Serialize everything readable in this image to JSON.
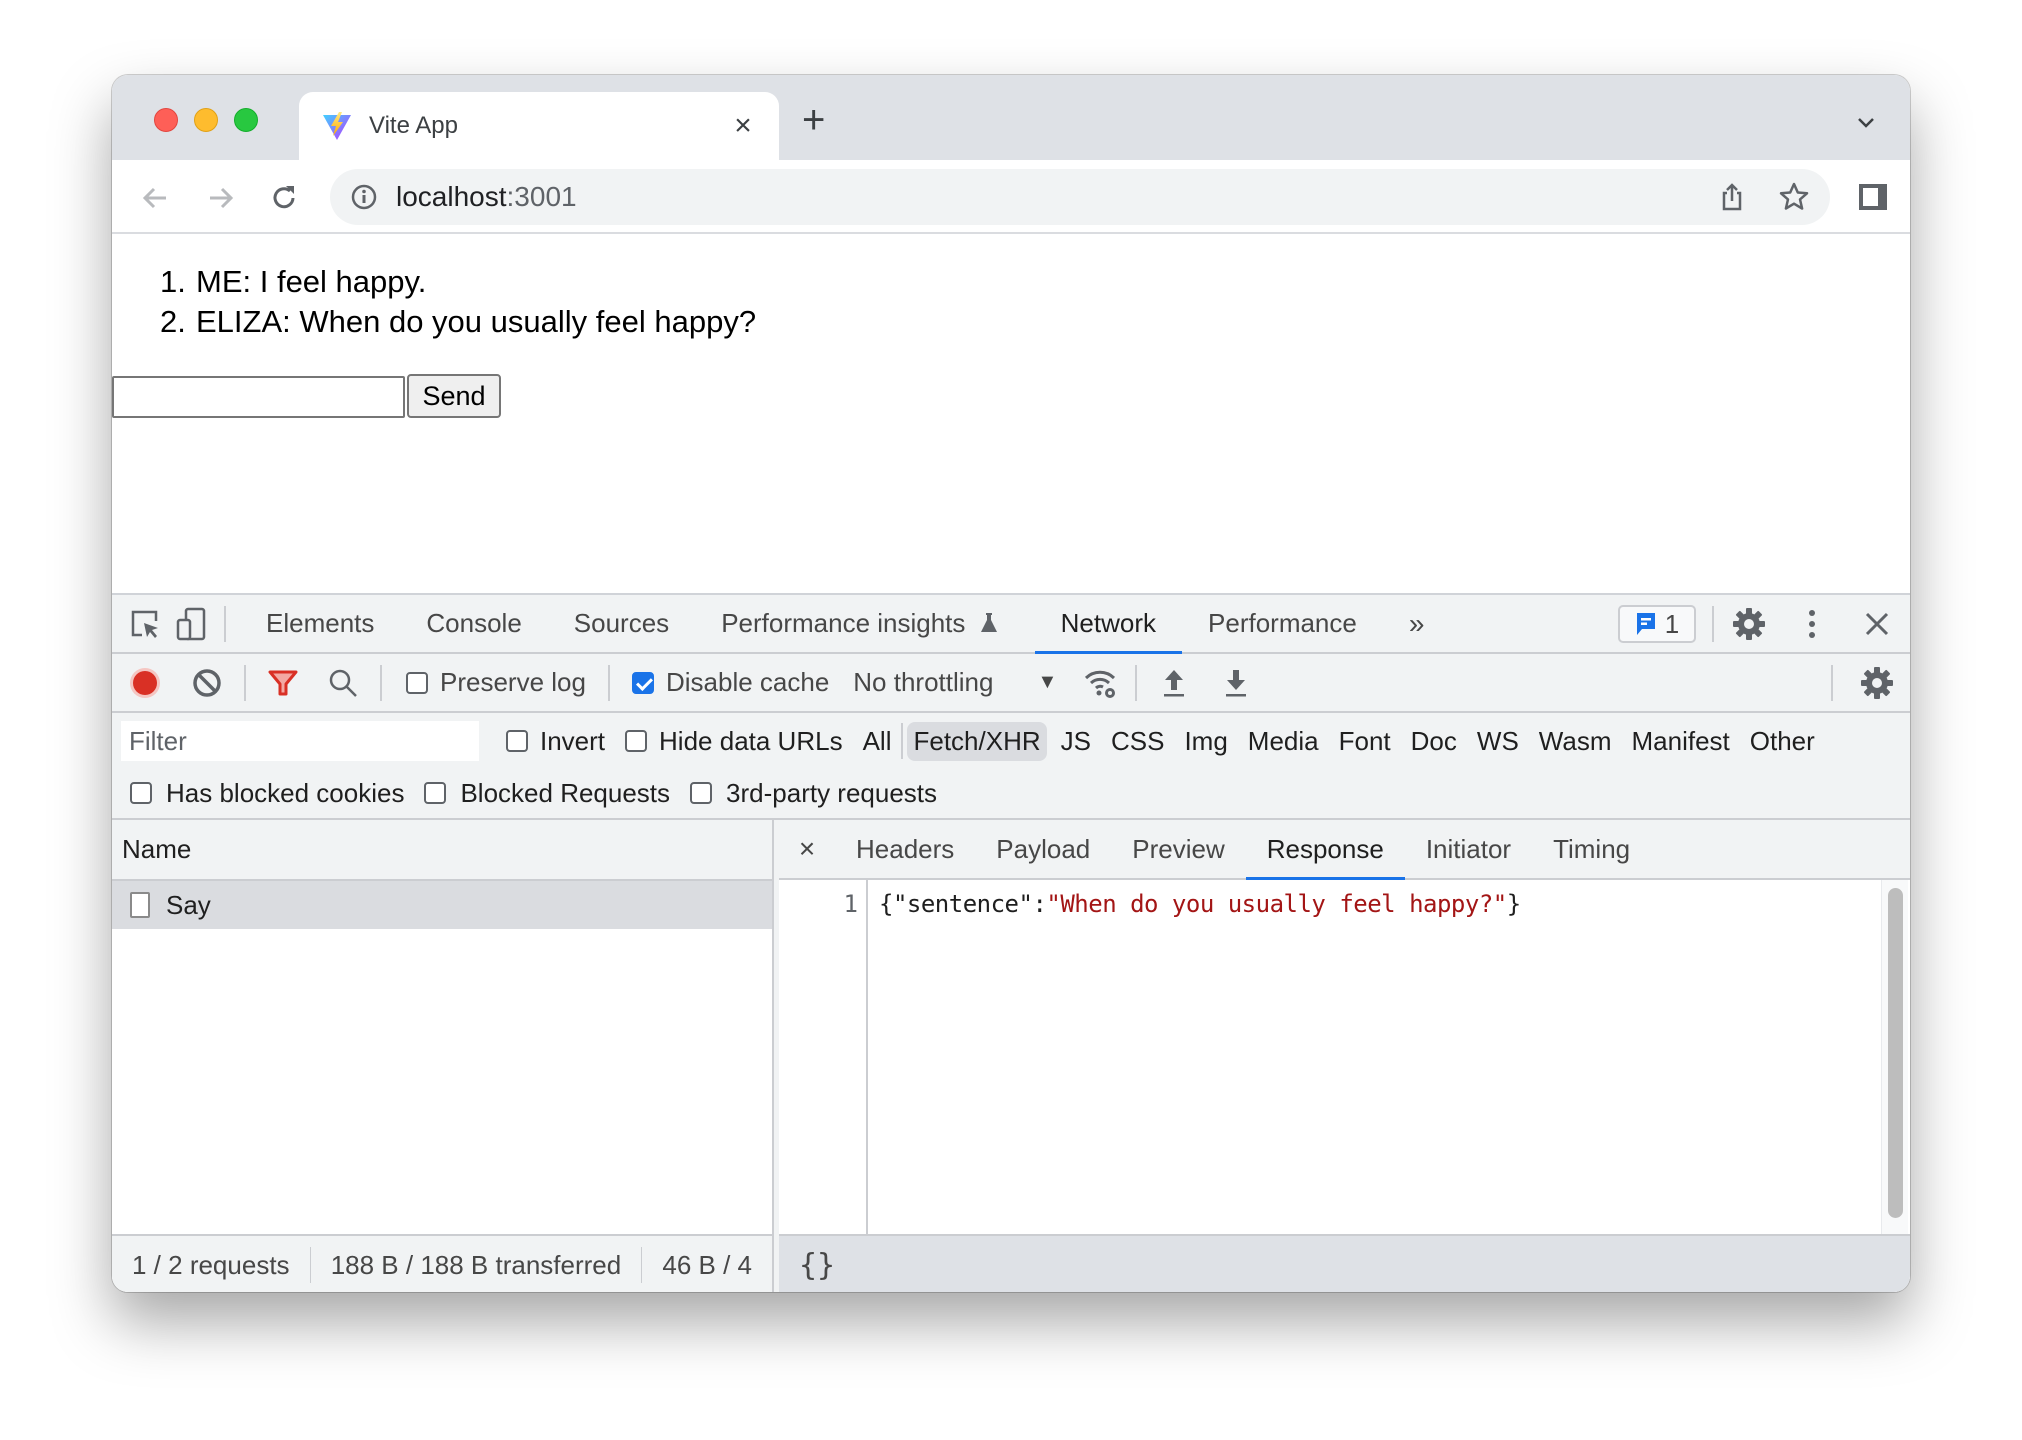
{
  "browser": {
    "tab": {
      "title": "Vite App",
      "favicon": "vite-logo-icon",
      "close_icon": "close-icon"
    },
    "new_tab_icon": "plus-icon",
    "tab_list_icon": "chevron-down-icon",
    "nav": {
      "back_icon": "arrow-left-icon",
      "forward_icon": "arrow-right-icon",
      "reload_icon": "reload-icon"
    },
    "address": {
      "host": "localhost",
      "port": ":3001",
      "info_icon": "info-icon"
    },
    "address_actions": [
      "share-icon",
      "bookmark-star-icon"
    ],
    "side_panel_icon": "side-panel-icon",
    "traffic_lights": {
      "close": "#fe5f57",
      "minimize": "#febc2e",
      "maximize": "#28c840"
    }
  },
  "page": {
    "messages": [
      {
        "num": "1.",
        "text": "ME: I feel happy."
      },
      {
        "num": "2.",
        "text": "ELIZA: When do you usually feel happy?"
      }
    ],
    "input": {
      "value": "",
      "placeholder": ""
    },
    "send_label": "Send"
  },
  "devtools": {
    "tabs": [
      {
        "label": "Elements",
        "active": false
      },
      {
        "label": "Console",
        "active": false
      },
      {
        "label": "Sources",
        "active": false
      },
      {
        "label": "Performance insights",
        "active": false,
        "icon": "flask-icon"
      },
      {
        "label": "Network",
        "active": true
      },
      {
        "label": "Performance",
        "active": false
      }
    ],
    "more_tabs_icon": "double-chevron-right-icon",
    "issues_count": "1",
    "accent": "#1a73e8",
    "toolbar": {
      "preserve_log": {
        "label": "Preserve log",
        "checked": false
      },
      "disable_cache": {
        "label": "Disable cache",
        "checked": true
      },
      "throttling": "No throttling"
    },
    "filter": {
      "placeholder": "Filter",
      "invert": {
        "label": "Invert",
        "checked": false
      },
      "hide_data_urls": {
        "label": "Hide data URLs",
        "checked": false
      },
      "types": [
        {
          "label": "All",
          "active": false
        },
        {
          "label": "Fetch/XHR",
          "active": true
        },
        {
          "label": "JS",
          "active": false
        },
        {
          "label": "CSS",
          "active": false
        },
        {
          "label": "Img",
          "active": false
        },
        {
          "label": "Media",
          "active": false
        },
        {
          "label": "Font",
          "active": false
        },
        {
          "label": "Doc",
          "active": false
        },
        {
          "label": "WS",
          "active": false
        },
        {
          "label": "Wasm",
          "active": false
        },
        {
          "label": "Manifest",
          "active": false
        },
        {
          "label": "Other",
          "active": false
        }
      ],
      "has_blocked_cookies": {
        "label": "Has blocked cookies",
        "checked": false
      },
      "blocked_requests": {
        "label": "Blocked Requests",
        "checked": false
      },
      "third_party": {
        "label": "3rd-party requests",
        "checked": false
      }
    },
    "requests": {
      "column_header": "Name",
      "rows": [
        {
          "name": "Say",
          "selected": true
        }
      ],
      "status": {
        "requests": "1 / 2 requests",
        "transferred": "188 B / 188 B transferred",
        "resources": "46 B / 4"
      }
    },
    "detail": {
      "tabs": [
        {
          "label": "Headers",
          "active": false
        },
        {
          "label": "Payload",
          "active": false
        },
        {
          "label": "Preview",
          "active": false
        },
        {
          "label": "Response",
          "active": true
        },
        {
          "label": "Initiator",
          "active": false
        },
        {
          "label": "Timing",
          "active": false
        }
      ],
      "response": {
        "line_number": "1",
        "prefix": "{\"sentence\":",
        "string_value": "\"When do you usually feel happy?\"",
        "suffix": "}"
      },
      "pretty_print_label": "{}"
    }
  }
}
